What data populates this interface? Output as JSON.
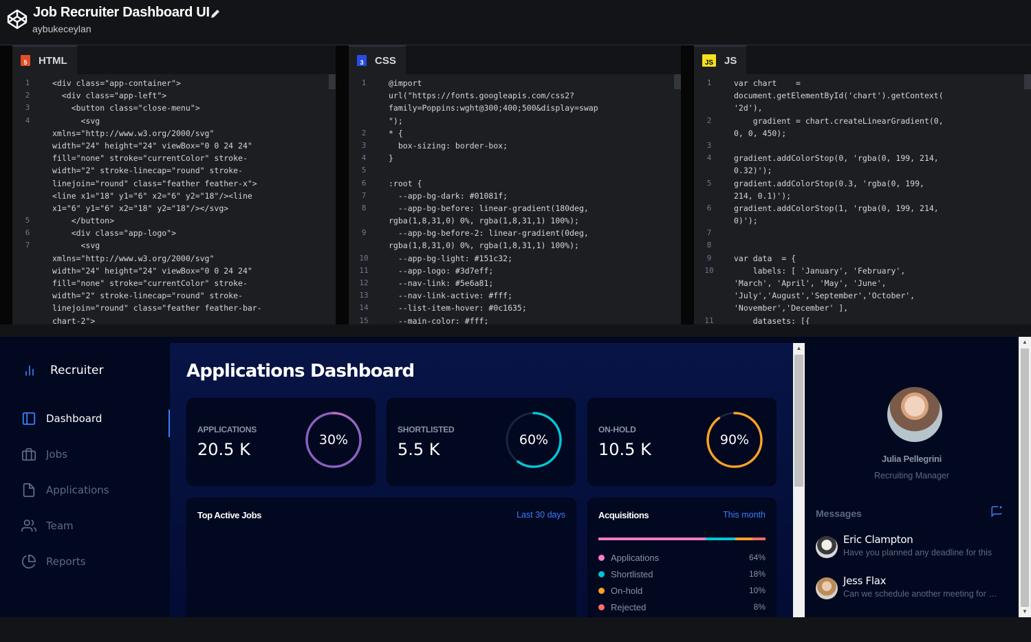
{
  "header": {
    "title": "Job Recruiter Dashboard UI",
    "author": "aybukeceylan"
  },
  "editors": [
    {
      "name": "HTML",
      "badge": "5",
      "badge_color": "#e44d26",
      "lines": [
        {
          "n": "1",
          "t": "<div class=\"app-container\">"
        },
        {
          "n": "2",
          "t": "  <div class=\"app-left\">"
        },
        {
          "n": "3",
          "t": "    <button class=\"close-menu\">"
        },
        {
          "n": "4",
          "t": "      <svg"
        },
        {
          "n": "",
          "t": "xmlns=\"http://www.w3.org/2000/svg\""
        },
        {
          "n": "",
          "t": "width=\"24\" height=\"24\" viewBox=\"0 0 24 24\""
        },
        {
          "n": "",
          "t": "fill=\"none\" stroke=\"currentColor\" stroke-"
        },
        {
          "n": "",
          "t": "width=\"2\" stroke-linecap=\"round\" stroke-"
        },
        {
          "n": "",
          "t": "linejoin=\"round\" class=\"feather feather-x\">"
        },
        {
          "n": "",
          "t": "<line x1=\"18\" y1=\"6\" x2=\"6\" y2=\"18\"/><line"
        },
        {
          "n": "",
          "t": "x1=\"6\" y1=\"6\" x2=\"18\" y2=\"18\"/></svg>"
        },
        {
          "n": "5",
          "t": "    </button>"
        },
        {
          "n": "6",
          "t": "    <div class=\"app-logo\">"
        },
        {
          "n": "7",
          "t": "      <svg"
        },
        {
          "n": "",
          "t": "xmlns=\"http://www.w3.org/2000/svg\""
        },
        {
          "n": "",
          "t": "width=\"24\" height=\"24\" viewBox=\"0 0 24 24\""
        },
        {
          "n": "",
          "t": "fill=\"none\" stroke=\"currentColor\" stroke-"
        },
        {
          "n": "",
          "t": "width=\"2\" stroke-linecap=\"round\" stroke-"
        },
        {
          "n": "",
          "t": "linejoin=\"round\" class=\"feather feather-bar-"
        },
        {
          "n": "",
          "t": "chart-2\">"
        }
      ]
    },
    {
      "name": "CSS",
      "badge": "3",
      "badge_color": "#264de4",
      "lines": [
        {
          "n": "1",
          "t": "@import"
        },
        {
          "n": "",
          "t": "url(\"https://fonts.googleapis.com/css2?"
        },
        {
          "n": "",
          "t": "family=Poppins:wght@300;400;500&display=swap"
        },
        {
          "n": "",
          "t": "\");"
        },
        {
          "n": "2",
          "t": "* {"
        },
        {
          "n": "3",
          "t": "  box-sizing: border-box;"
        },
        {
          "n": "4",
          "t": "}"
        },
        {
          "n": "5",
          "t": ""
        },
        {
          "n": "6",
          "t": ":root {"
        },
        {
          "n": "7",
          "t": "  --app-bg-dark: #01081f;"
        },
        {
          "n": "8",
          "t": "  --app-bg-before: linear-gradient(180deg,"
        },
        {
          "n": "",
          "t": "rgba(1,8,31,0) 0%, rgba(1,8,31,1) 100%);"
        },
        {
          "n": "9",
          "t": "  --app-bg-before-2: linear-gradient(0deg,"
        },
        {
          "n": "",
          "t": "rgba(1,8,31,0) 0%, rgba(1,8,31,1) 100%);"
        },
        {
          "n": "10",
          "t": "  --app-bg-light: #151c32;"
        },
        {
          "n": "11",
          "t": "  --app-logo: #3d7eff;"
        },
        {
          "n": "12",
          "t": "  --nav-link: #5e6a81;"
        },
        {
          "n": "13",
          "t": "  --nav-link-active: #fff;"
        },
        {
          "n": "14",
          "t": "  --list-item-hover: #0c1635;"
        },
        {
          "n": "15",
          "t": "  --main-color: #fff;"
        }
      ]
    },
    {
      "name": "JS",
      "badge": "JS",
      "badge_color": "#f7df1e",
      "lines": [
        {
          "n": "1",
          "t": "var chart    ="
        },
        {
          "n": "",
          "t": "document.getElementById('chart').getContext("
        },
        {
          "n": "",
          "t": "'2d'),"
        },
        {
          "n": "2",
          "t": "    gradient = chart.createLinearGradient(0,"
        },
        {
          "n": "",
          "t": "0, 0, 450);"
        },
        {
          "n": "3",
          "t": ""
        },
        {
          "n": "4",
          "t": "gradient.addColorStop(0, 'rgba(0, 199, 214,"
        },
        {
          "n": "",
          "t": "0.32)');"
        },
        {
          "n": "5",
          "t": "gradient.addColorStop(0.3, 'rgba(0, 199,"
        },
        {
          "n": "",
          "t": "214, 0.1)');"
        },
        {
          "n": "6",
          "t": "gradient.addColorStop(1, 'rgba(0, 199, 214,"
        },
        {
          "n": "",
          "t": "0)');"
        },
        {
          "n": "7",
          "t": ""
        },
        {
          "n": "8",
          "t": ""
        },
        {
          "n": "9",
          "t": "var data  = {"
        },
        {
          "n": "10",
          "t": "    labels: [ 'January', 'February',"
        },
        {
          "n": "",
          "t": "'March', 'April', 'May', 'June',"
        },
        {
          "n": "",
          "t": "'July','August','September','October',"
        },
        {
          "n": "",
          "t": "'November','December' ],"
        },
        {
          "n": "11",
          "t": "    datasets: [{"
        }
      ]
    }
  ],
  "app": {
    "logo_text": "Recruiter",
    "nav": [
      {
        "label": "Dashboard",
        "icon": "layout-icon",
        "active": true
      },
      {
        "label": "Jobs",
        "icon": "briefcase-icon",
        "active": false
      },
      {
        "label": "Applications",
        "icon": "file-icon",
        "active": false
      },
      {
        "label": "Team",
        "icon": "users-icon",
        "active": false
      },
      {
        "label": "Reports",
        "icon": "pie-chart-icon",
        "active": false
      }
    ],
    "title": "Applications Dashboard",
    "stats": [
      {
        "label": "APPLICATIONS",
        "value": "20.5 K",
        "percent_text": "30%",
        "percent": 30,
        "color": "#ff7ac6",
        "color2": "#8c5fbf"
      },
      {
        "label": "SHORTLISTED",
        "value": "5.5 K",
        "percent_text": "60%",
        "percent": 60,
        "color": "#00c7d6",
        "color2": "#00c7d6"
      },
      {
        "label": "ON-HOLD",
        "value": "10.5 K",
        "percent_text": "90%",
        "percent": 90,
        "color": "#ffa126",
        "color2": "#ffa126"
      }
    ],
    "top_jobs": {
      "title": "Top Active Jobs",
      "link": "Last 30 days"
    },
    "acquisitions": {
      "title": "Acquisitions",
      "link": "This month",
      "items": [
        {
          "name": "Applications",
          "value": "64%",
          "share": 64,
          "color": "#ff7ac6"
        },
        {
          "name": "Shortlisted",
          "value": "18%",
          "share": 18,
          "color": "#00c7d6"
        },
        {
          "name": "On-hold",
          "value": "10%",
          "share": 10,
          "color": "#ffa126"
        },
        {
          "name": "Rejected",
          "value": "8%",
          "share": 8,
          "color": "#ff6b6b"
        }
      ]
    },
    "profile": {
      "name": "Julia Pellegrini",
      "role": "Recruiting Manager"
    },
    "messages": {
      "title": "Messages",
      "items": [
        {
          "name": "Eric Clampton",
          "text": "Have you planned any deadline for this"
        },
        {
          "name": "Jess Flax",
          "text": "Can we schedule another meeting for next"
        }
      ]
    }
  }
}
